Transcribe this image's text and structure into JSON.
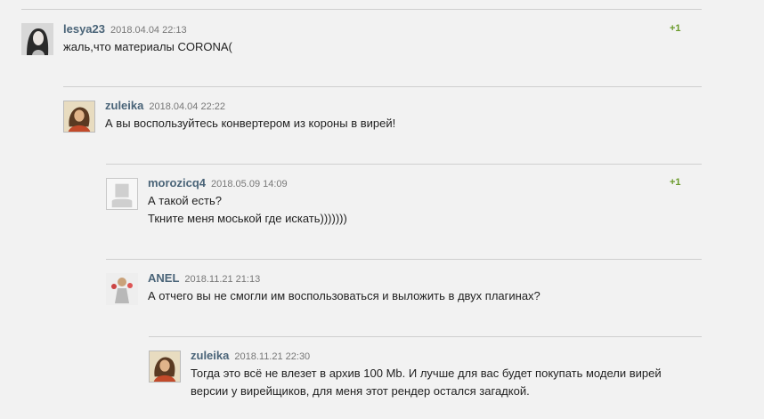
{
  "comments": [
    {
      "author": "lesya23",
      "date": "2018.04.04 22:13",
      "rating": "+1",
      "lines": [
        "жаль,что материалы CORONA("
      ],
      "avatar": "photo-avatar-dark-hair"
    },
    {
      "author": "zuleika",
      "date": "2018.04.04 22:22",
      "rating": "",
      "lines": [
        "А вы воспользуйтесь конвертером из короны в вирей!"
      ],
      "avatar": "painted-portrait-avatar"
    },
    {
      "author": "morozicq4",
      "date": "2018.05.09 14:09",
      "rating": "+1",
      "lines": [
        "А такой есть?",
        "Ткните меня моськой где искать)))))))"
      ],
      "avatar": "default-user-avatar"
    },
    {
      "author": "ANEL",
      "date": "2018.11.21 21:13",
      "rating": "",
      "lines": [
        "А отчего вы не смогли им воспользоваться и выложить в двух плагинах?"
      ],
      "avatar": "figure-avatar"
    },
    {
      "author": "zuleika",
      "date": "2018.11.21 22:30",
      "rating": "",
      "lines": [
        "Тогда это всё не влезет в архив 100 Mb. И лучше для вас будет покупать модели вирей",
        "версии у вирейщиков, для меня этот рендер остался загадкой."
      ],
      "avatar": "painted-portrait-avatar"
    }
  ],
  "colors": {
    "background": "#f2f2f2",
    "divider": "#cfcfcf",
    "author": "#4a6478",
    "date": "#777777",
    "rating": "#6a9a2a",
    "text": "#222222"
  }
}
